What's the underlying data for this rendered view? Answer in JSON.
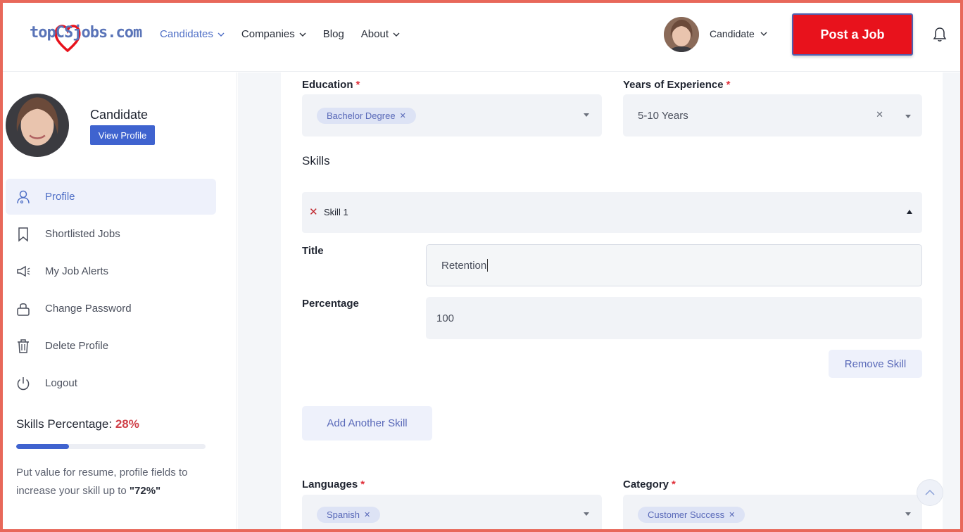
{
  "header": {
    "logo_text": "topCSjobs.com",
    "nav": [
      {
        "label": "Candidates",
        "has_dropdown": true,
        "active": true
      },
      {
        "label": "Companies",
        "has_dropdown": true,
        "active": false
      },
      {
        "label": "Blog",
        "has_dropdown": false,
        "active": false
      },
      {
        "label": "About",
        "has_dropdown": true,
        "active": false
      }
    ],
    "user_label": "Candidate",
    "post_job_label": "Post a Job"
  },
  "sidebar": {
    "name": "Candidate",
    "view_profile_label": "View Profile",
    "menu": [
      {
        "label": "Profile",
        "icon": "user-icon",
        "active": true
      },
      {
        "label": "Shortlisted Jobs",
        "icon": "bookmark-icon",
        "active": false
      },
      {
        "label": "My Job Alerts",
        "icon": "megaphone-icon",
        "active": false
      },
      {
        "label": "Change Password",
        "icon": "lock-icon",
        "active": false
      },
      {
        "label": "Delete Profile",
        "icon": "trash-icon",
        "active": false
      },
      {
        "label": "Logout",
        "icon": "power-icon",
        "active": false
      }
    ],
    "skills_percentage_label": "Skills Percentage:",
    "skills_percentage_value": "28%",
    "skills_progress": 0.28,
    "skills_note_prefix": "Put value for resume, profile fields to increase your skill up to ",
    "skills_note_target": "\"72%\""
  },
  "form": {
    "education": {
      "label": "Education",
      "required_mark": "*",
      "selected": [
        "Bachelor Degree"
      ]
    },
    "experience": {
      "label": "Years of Experience",
      "required_mark": "*",
      "value": "5-10 Years"
    },
    "skills_section_title": "Skills",
    "skill": {
      "name": "Skill 1",
      "title_label": "Title",
      "title_value": "Retention",
      "percentage_label": "Percentage",
      "percentage_value": "100",
      "remove_label": "Remove Skill"
    },
    "add_skill_label": "Add Another Skill",
    "languages": {
      "label": "Languages",
      "required_mark": "*",
      "selected": [
        "Spanish"
      ]
    },
    "category": {
      "label": "Category",
      "required_mark": "*",
      "selected": [
        "Customer Success"
      ]
    }
  },
  "colors": {
    "accent": "#3f63cf",
    "post_job": "#e8121c",
    "percentage_red": "#d0424a",
    "frame": "#e8685a"
  }
}
